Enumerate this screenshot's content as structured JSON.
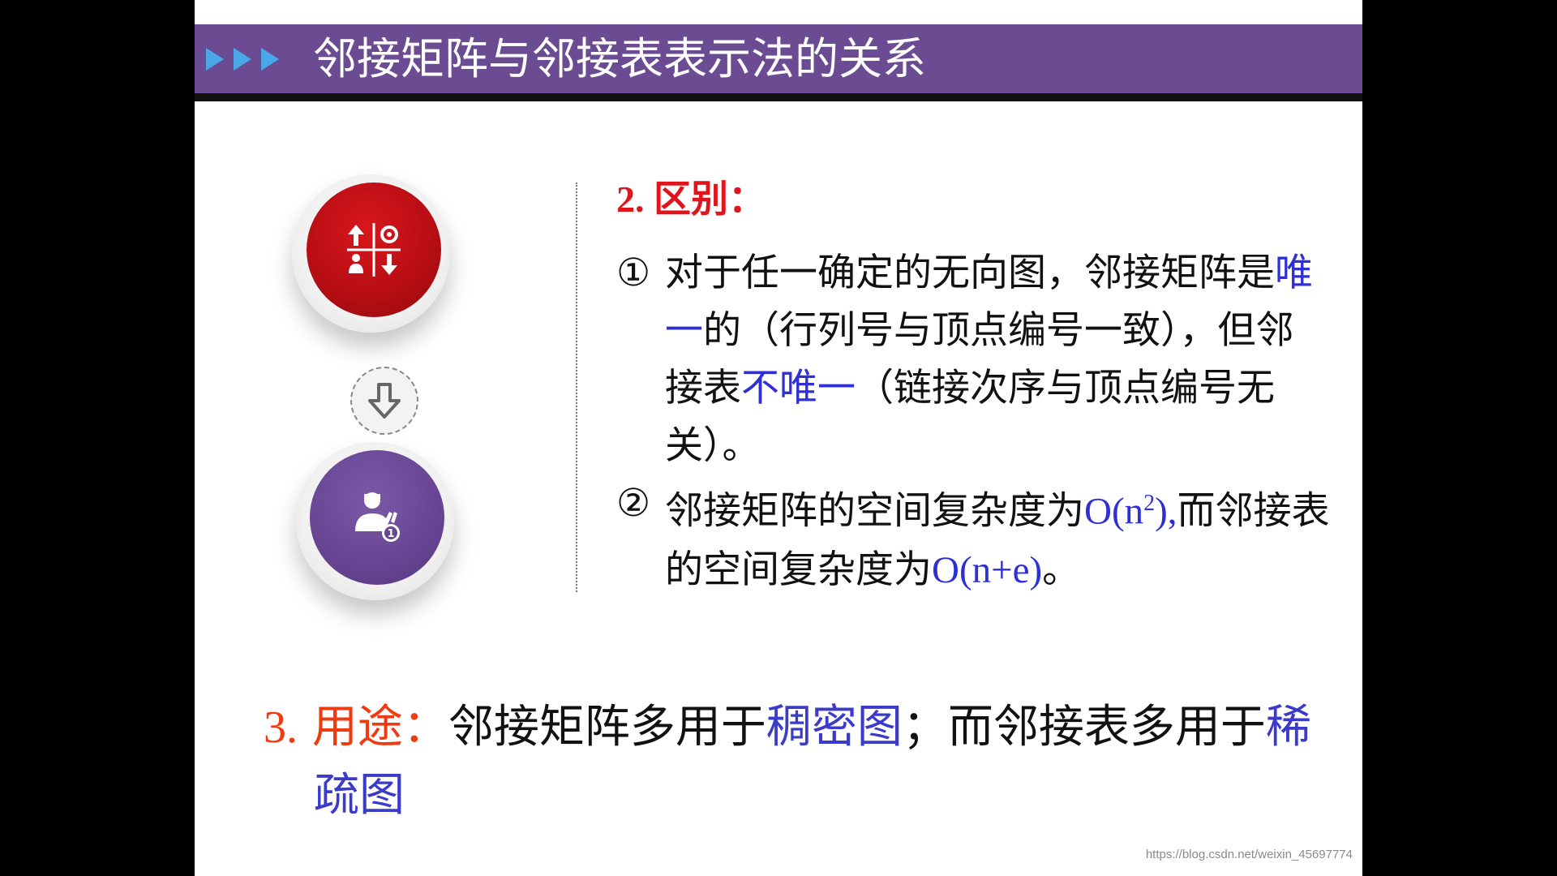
{
  "title": "邻接矩阵与邻接表表示法的关系",
  "section2": {
    "heading_num": "2.",
    "heading_text": "区别：",
    "item1": {
      "num": "①",
      "p1": "对于任一确定的无向图，邻接矩阵是",
      "p2_blue": "唯一",
      "p3": "的（行列号与顶点编号一致），",
      "p4": "但邻接表",
      "p5_blue": "不唯一",
      "p6": "（链接次序与顶点编号无关）。"
    },
    "item2": {
      "num": "②",
      "p1": "邻接矩阵的空间复杂度为",
      "p2_blue_a": "O(n",
      "p2_sup": "2",
      "p2_blue_b": "),",
      "p3": "而邻接表的空间复杂度为",
      "p4_blue": "O(n+e)",
      "p5": "。"
    }
  },
  "section3": {
    "num": "3.",
    "label": "用途：",
    "t1": "邻接矩阵多用于",
    "b1": "稠密图",
    "t2": "；而邻接表多用于",
    "b2a": "稀",
    "b2b": "疏图"
  },
  "icons": {
    "top": "process-flow-icon",
    "middle": "arrow-down-circle-icon",
    "bottom": "award-person-icon"
  },
  "watermark": "https://blog.csdn.net/weixin_45697774",
  "colors": {
    "title_bar": "#6b4c93",
    "accent_red": "#e0141b",
    "accent_blue": "#2f2fd6",
    "usage_label": "#f03a12"
  }
}
